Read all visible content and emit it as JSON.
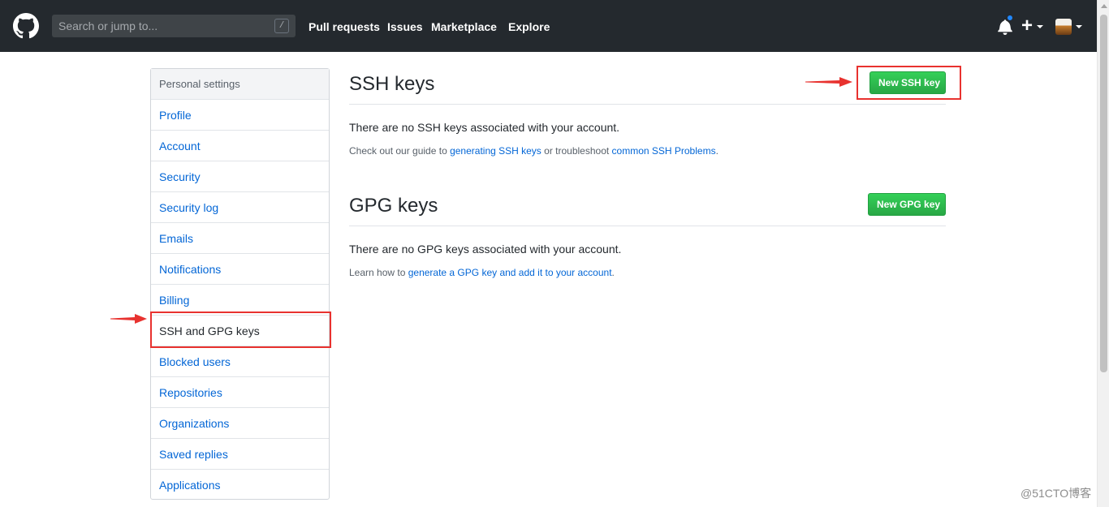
{
  "header": {
    "search_placeholder": "Search or jump to...",
    "search_shortcut": "/",
    "nav": [
      "Pull requests",
      "Issues",
      "Marketplace",
      "Explore"
    ],
    "plus": "+"
  },
  "sidebar": {
    "heading": "Personal settings",
    "items": [
      {
        "label": "Profile"
      },
      {
        "label": "Account"
      },
      {
        "label": "Security"
      },
      {
        "label": "Security log"
      },
      {
        "label": "Emails"
      },
      {
        "label": "Notifications"
      },
      {
        "label": "Billing"
      },
      {
        "label": "SSH and GPG keys",
        "selected": true
      },
      {
        "label": "Blocked users"
      },
      {
        "label": "Repositories"
      },
      {
        "label": "Organizations"
      },
      {
        "label": "Saved replies"
      },
      {
        "label": "Applications"
      }
    ]
  },
  "ssh": {
    "title": "SSH keys",
    "button": "New SSH key",
    "empty": "There are no SSH keys associated with your account.",
    "note_prefix": "Check out our guide to ",
    "note_link1": "generating SSH keys",
    "note_middle": " or troubleshoot ",
    "note_link2": "common SSH Problems",
    "note_suffix": "."
  },
  "gpg": {
    "title": "GPG keys",
    "button": "New GPG key",
    "empty": "There are no GPG keys associated with your account.",
    "note_prefix": "Learn how to ",
    "note_link": "generate a GPG key and add it to your account",
    "note_suffix": "."
  },
  "watermark": "@51CTO博客",
  "colors": {
    "header_bg": "#24292e",
    "link": "#0366d6",
    "button_green": "#28a745",
    "annotation_red": "#e8322f"
  }
}
